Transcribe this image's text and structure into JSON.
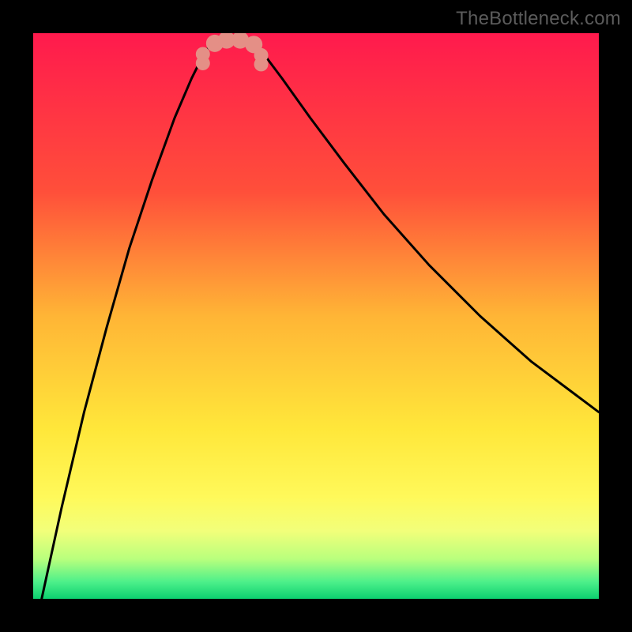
{
  "watermark": "TheBottleneck.com",
  "chart_data": {
    "type": "line",
    "title": "",
    "xlabel": "",
    "ylabel": "",
    "xlim": [
      0,
      1
    ],
    "ylim": [
      0,
      1
    ],
    "gradient_stops": [
      {
        "offset": 0.0,
        "color": "#ff1a4d"
      },
      {
        "offset": 0.28,
        "color": "#ff4f3a"
      },
      {
        "offset": 0.5,
        "color": "#ffb536"
      },
      {
        "offset": 0.7,
        "color": "#ffe73a"
      },
      {
        "offset": 0.82,
        "color": "#fff95a"
      },
      {
        "offset": 0.88,
        "color": "#f2ff7a"
      },
      {
        "offset": 0.93,
        "color": "#b8ff7d"
      },
      {
        "offset": 0.97,
        "color": "#4df08a"
      },
      {
        "offset": 1.0,
        "color": "#0cd070"
      }
    ],
    "series": [
      {
        "name": "bottleneck-curve",
        "stroke": "#000000",
        "stroke_width": 3,
        "x": [
          0.015,
          0.05,
          0.09,
          0.13,
          0.17,
          0.21,
          0.25,
          0.28,
          0.3,
          0.31,
          0.32,
          0.335,
          0.355,
          0.385,
          0.395,
          0.41,
          0.44,
          0.49,
          0.55,
          0.62,
          0.7,
          0.79,
          0.88,
          0.96,
          1.0
        ],
        "y": [
          0.0,
          0.16,
          0.33,
          0.48,
          0.62,
          0.74,
          0.85,
          0.92,
          0.96,
          0.975,
          0.985,
          0.992,
          0.992,
          0.985,
          0.975,
          0.96,
          0.92,
          0.85,
          0.77,
          0.68,
          0.59,
          0.5,
          0.42,
          0.36,
          0.33
        ]
      }
    ],
    "markers": {
      "name": "highlight-dots",
      "color": "#e48f86",
      "radius_pairs": 9,
      "radius_single": 11,
      "points": [
        {
          "x": 0.3,
          "y": 0.947,
          "type": "pair"
        },
        {
          "x": 0.3,
          "y": 0.963,
          "type": "pair"
        },
        {
          "x": 0.321,
          "y": 0.982,
          "type": "single"
        },
        {
          "x": 0.342,
          "y": 0.988,
          "type": "single"
        },
        {
          "x": 0.366,
          "y": 0.988,
          "type": "single"
        },
        {
          "x": 0.39,
          "y": 0.98,
          "type": "single"
        },
        {
          "x": 0.403,
          "y": 0.945,
          "type": "pair"
        },
        {
          "x": 0.403,
          "y": 0.961,
          "type": "pair"
        }
      ]
    }
  }
}
